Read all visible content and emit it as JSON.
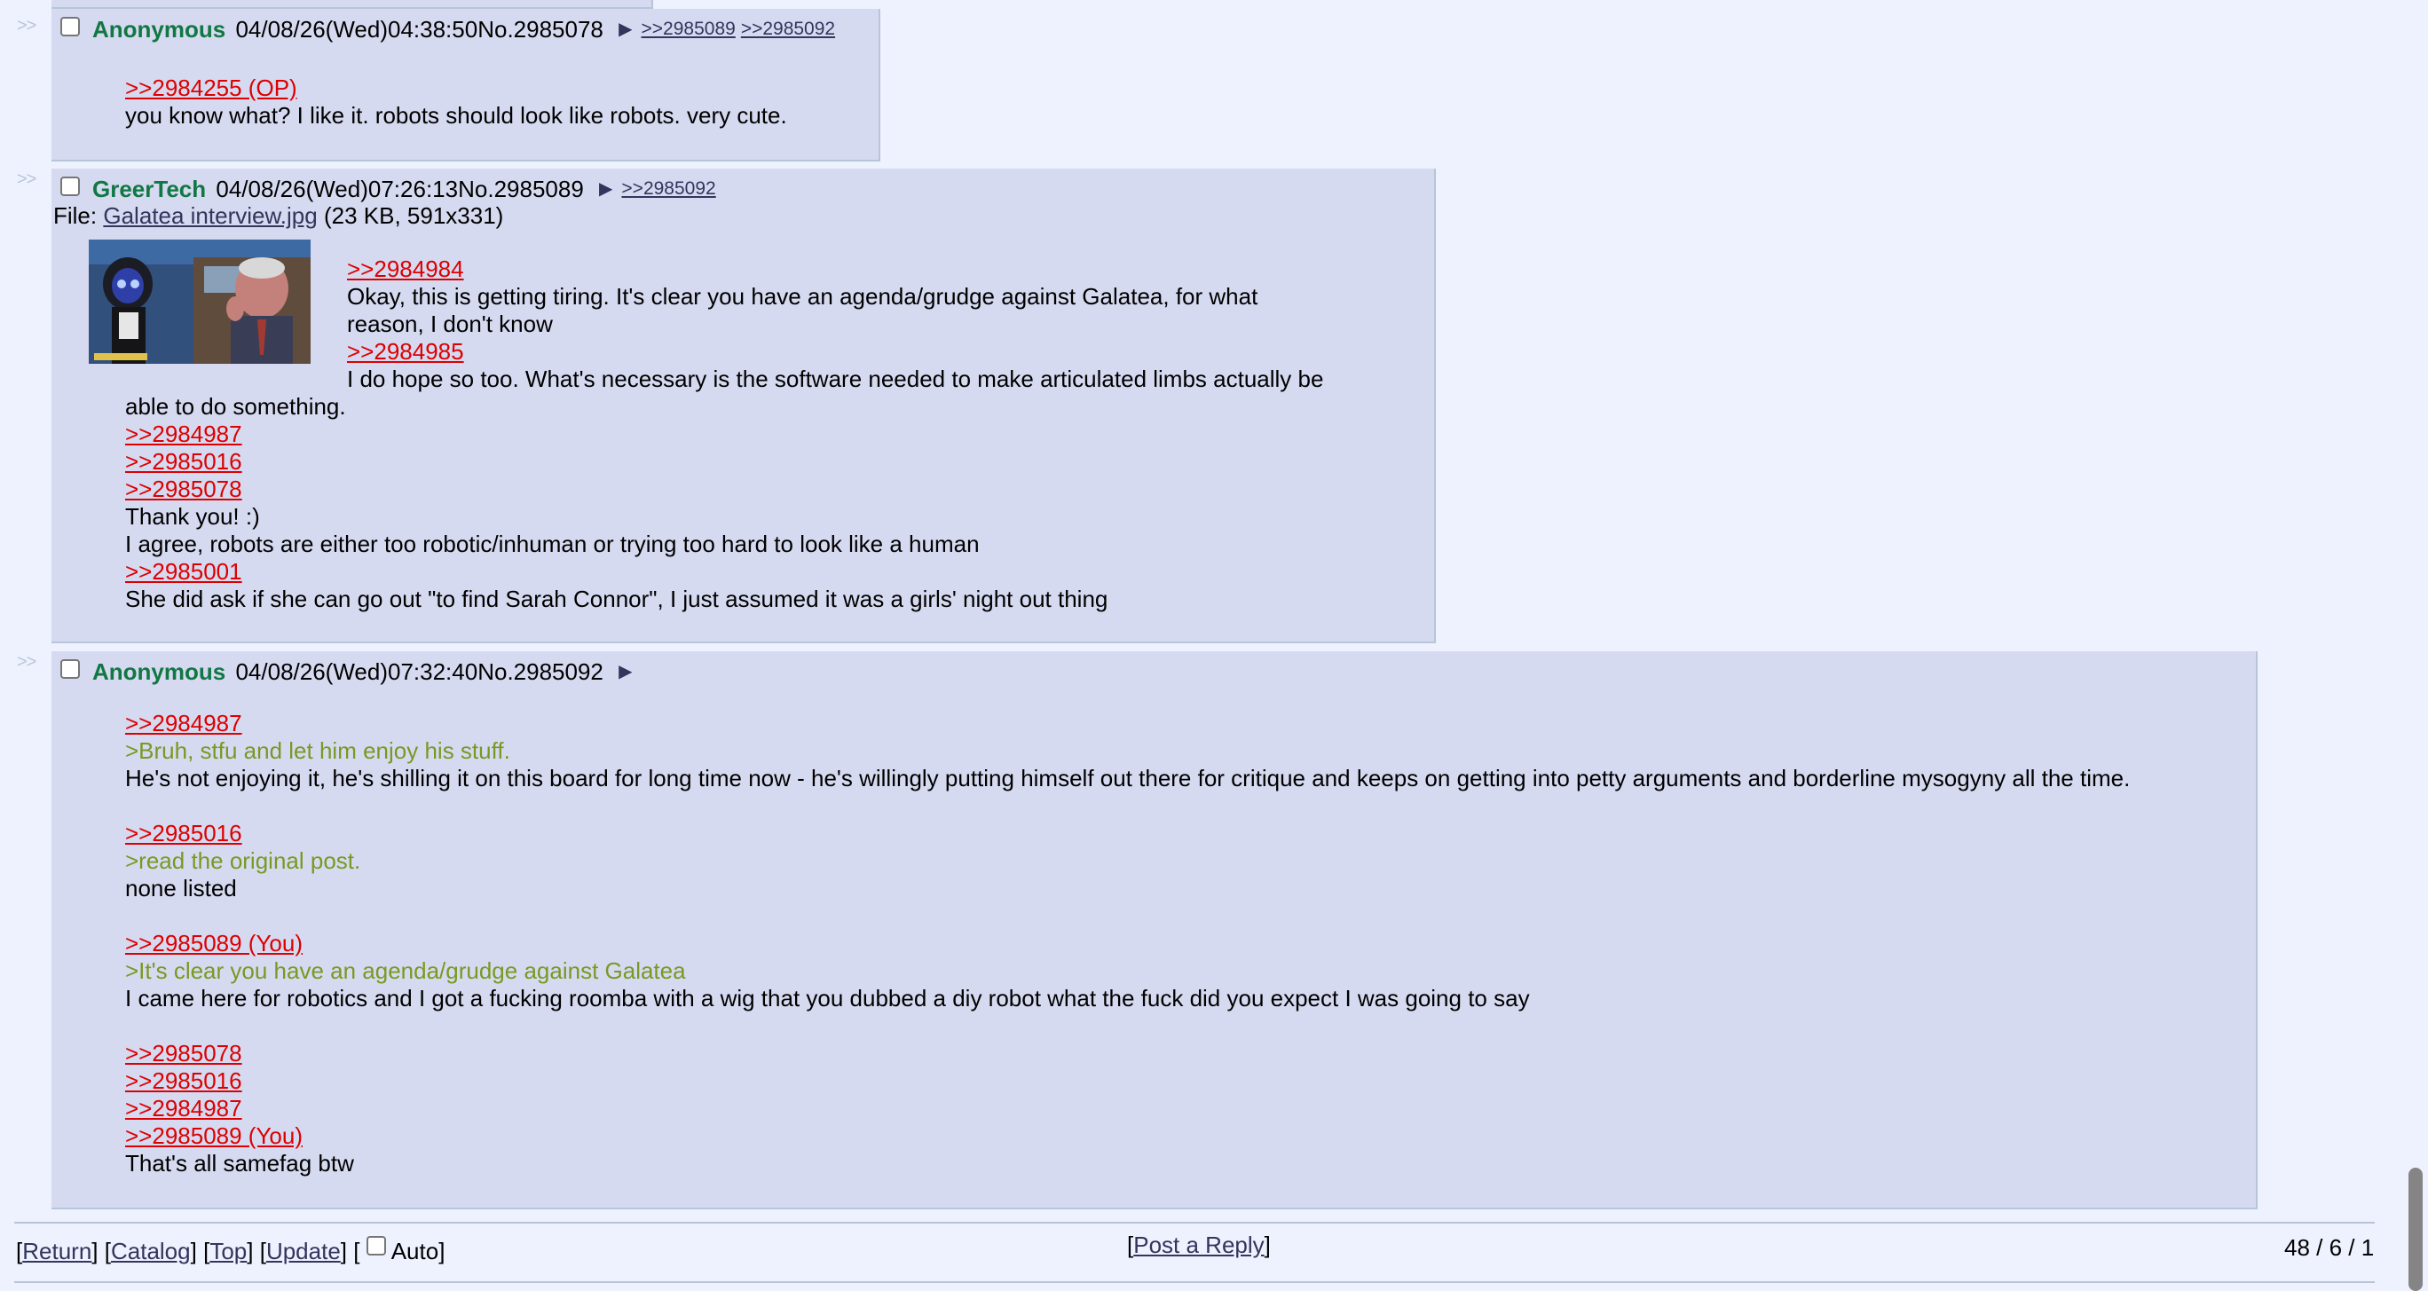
{
  "side_arrow": ">>",
  "posts": [
    {
      "name": "Anonymous",
      "datetime": "04/08/26(Wed)04:38:50",
      "number": "No.2985078",
      "backlinks": [
        ">>2985089",
        ">>2985092"
      ],
      "lines": [
        {
          "type": "quote",
          "text": ">>2984255 (OP)"
        },
        {
          "type": "text",
          "text": "you know what? I like it. robots should look like robots. very cute."
        }
      ]
    },
    {
      "name": "GreerTech",
      "datetime": "04/08/26(Wed)07:26:13",
      "number": "No.2985089",
      "backlinks": [
        ">>2985092"
      ],
      "file": {
        "label": "File:",
        "filename": "Galatea interview.jpg",
        "meta": "(23 KB, 591x331)",
        "thumbnail": "robot-interview-thumbnail"
      },
      "lines": [
        {
          "type": "quote",
          "text": ">>2984984"
        },
        {
          "type": "text",
          "text": "Okay, this is getting tiring. It's clear you have an agenda/grudge against Galatea, for what"
        },
        {
          "type": "text",
          "text": "reason, I don't know"
        },
        {
          "type": "quote",
          "text": ">>2984985"
        },
        {
          "type": "text",
          "text": "I do hope so too. What's necessary is the software needed to make articulated limbs actually be"
        },
        {
          "type": "text",
          "text": "able to do something."
        },
        {
          "type": "quote",
          "text": ">>2984987"
        },
        {
          "type": "quote",
          "text": ">>2985016"
        },
        {
          "type": "quote",
          "text": ">>2985078"
        },
        {
          "type": "text",
          "text": "Thank you! :)"
        },
        {
          "type": "text",
          "text": "I agree, robots are either too robotic/inhuman or trying too hard to look like a human"
        },
        {
          "type": "quote",
          "text": ">>2985001"
        },
        {
          "type": "text",
          "text": "She did ask if she can go out \"to find Sarah Connor\", I just assumed it was a girls' night out thing"
        }
      ]
    },
    {
      "name": "Anonymous",
      "datetime": "04/08/26(Wed)07:32:40",
      "number": "No.2985092",
      "backlinks": [],
      "lines": [
        {
          "type": "quote",
          "text": ">>2984987"
        },
        {
          "type": "green",
          "text": ">Bruh, stfu and let him enjoy his stuff."
        },
        {
          "type": "text",
          "text": "He's not enjoying it, he's shilling it on this board for long time now - he's willingly putting himself out there for critique and keeps on getting into petty arguments and borderline mysogyny all the time."
        },
        {
          "type": "gap",
          "text": ""
        },
        {
          "type": "quote",
          "text": ">>2985016"
        },
        {
          "type": "green",
          "text": ">read the original post."
        },
        {
          "type": "text",
          "text": "none listed"
        },
        {
          "type": "gap",
          "text": ""
        },
        {
          "type": "quote",
          "text": ">>2985089 (You)"
        },
        {
          "type": "green",
          "text": ">It's clear you have an agenda/grudge against Galatea"
        },
        {
          "type": "text",
          "text": "I came here for robotics and I got a fucking roomba with a wig that you dubbed a diy robot what the fuck did you expect I was going to say"
        },
        {
          "type": "gap",
          "text": ""
        },
        {
          "type": "quote",
          "text": ">>2985078"
        },
        {
          "type": "quote",
          "text": ">>2985016"
        },
        {
          "type": "quote",
          "text": ">>2984987"
        },
        {
          "type": "quote",
          "text": ">>2985089 (You)"
        },
        {
          "type": "text",
          "text": "That's all samefag btw"
        }
      ]
    }
  ],
  "footer": {
    "return": "Return",
    "catalog": "Catalog",
    "top": "Top",
    "update": "Update",
    "auto": "Auto",
    "post_reply": "Post a Reply",
    "stats": "48 / 6 / 1"
  },
  "colors": {
    "background": "#eef2ff",
    "post_background": "#d6daf0",
    "name": "#117743",
    "quotelink": "#dd0000",
    "greentext": "#789922",
    "link": "#34345c"
  }
}
